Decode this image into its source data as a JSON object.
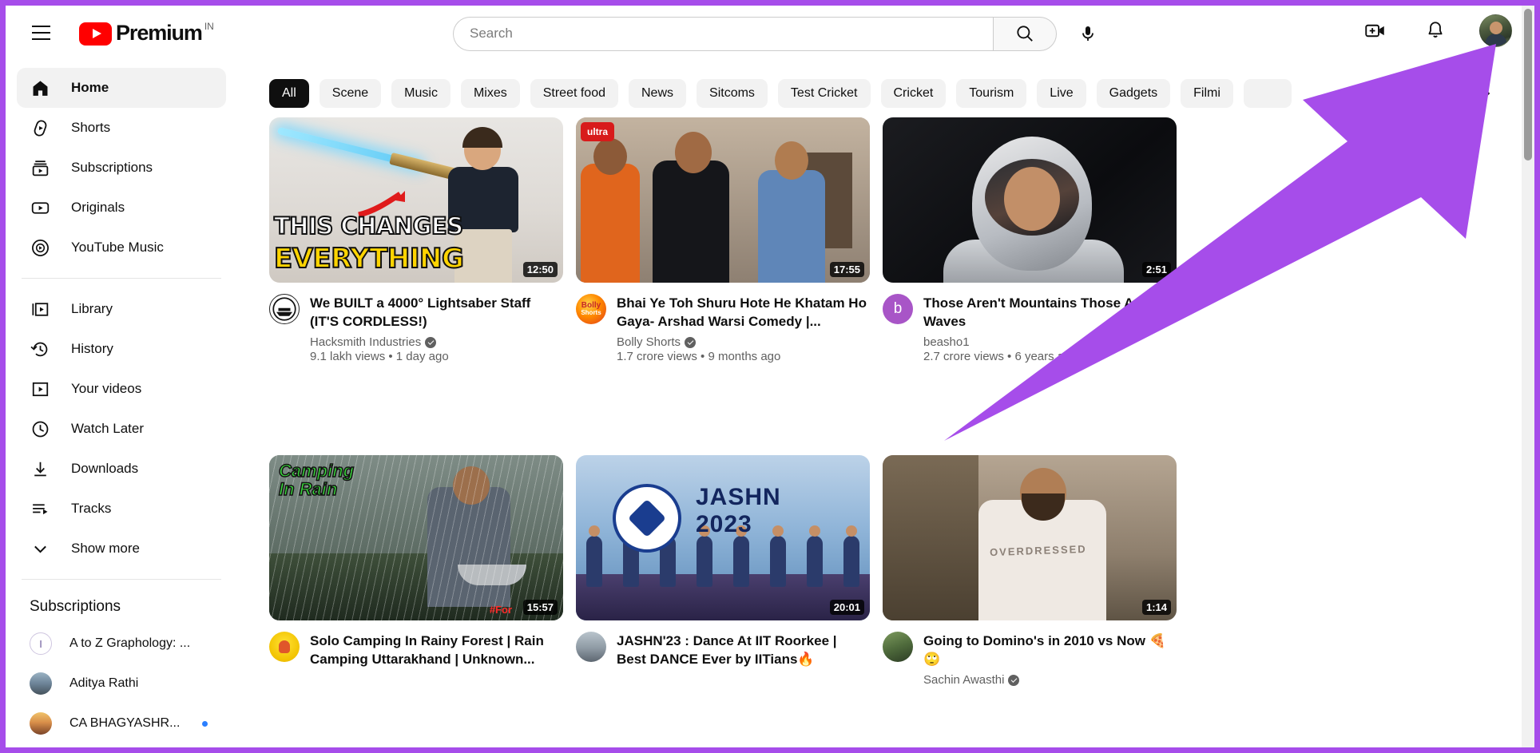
{
  "header": {
    "menu_label": "Menu",
    "logo_text": "Premium",
    "country_code": "IN",
    "search_placeholder": "Search",
    "search_value": "",
    "search_button_label": "Search",
    "mic_label": "Search with your voice",
    "create_label": "Create",
    "notifications_label": "Notifications",
    "account_label": "Account"
  },
  "sidebar": {
    "primary": [
      {
        "label": "Home",
        "icon": "home-icon",
        "active": true
      },
      {
        "label": "Shorts",
        "icon": "shorts-icon",
        "active": false
      },
      {
        "label": "Subscriptions",
        "icon": "subscriptions-icon",
        "active": false
      },
      {
        "label": "Originals",
        "icon": "originals-icon",
        "active": false
      },
      {
        "label": "YouTube Music",
        "icon": "youtube-music-icon",
        "active": false
      }
    ],
    "secondary": [
      {
        "label": "Library",
        "icon": "library-icon"
      },
      {
        "label": "History",
        "icon": "history-icon"
      },
      {
        "label": "Your videos",
        "icon": "your-videos-icon"
      },
      {
        "label": "Watch Later",
        "icon": "watch-later-icon"
      },
      {
        "label": "Downloads",
        "icon": "downloads-icon"
      },
      {
        "label": "Tracks",
        "icon": "tracks-icon"
      },
      {
        "label": "Show more",
        "icon": "chevron-down-icon"
      }
    ],
    "subscriptions_title": "Subscriptions",
    "subscriptions": [
      {
        "label": "A to Z Graphology: ...",
        "new": false
      },
      {
        "label": "Aditya Rathi",
        "new": false
      },
      {
        "label": "CA BHAGYASHR...",
        "new": true
      }
    ]
  },
  "chips": {
    "items": [
      {
        "label": "All",
        "selected": true
      },
      {
        "label": "Scene",
        "selected": false
      },
      {
        "label": "Music",
        "selected": false
      },
      {
        "label": "Mixes",
        "selected": false
      },
      {
        "label": "Street food",
        "selected": false
      },
      {
        "label": "News",
        "selected": false
      },
      {
        "label": "Sitcoms",
        "selected": false
      },
      {
        "label": "Test Cricket",
        "selected": false
      },
      {
        "label": "Cricket",
        "selected": false
      },
      {
        "label": "Tourism",
        "selected": false
      },
      {
        "label": "Live",
        "selected": false
      },
      {
        "label": "Gadgets",
        "selected": false
      },
      {
        "label": "Filmi",
        "selected": false
      }
    ],
    "next_label": "Next"
  },
  "videos": [
    {
      "title": "We BUILT a 4000° Lightsaber Staff (IT'S CORDLESS!)",
      "channel": "Hacksmith Industries",
      "verified": true,
      "stats": "9.1 lakh views • 1 day ago",
      "duration": "12:50",
      "thumb_text_1": "THIS CHANGES",
      "thumb_text_2": "EVERYTHING",
      "avatar_letter": ""
    },
    {
      "title": "Bhai Ye Toh Shuru Hote He Khatam Ho Gaya- Arshad Warsi Comedy |...",
      "channel": "Bolly Shorts",
      "verified": true,
      "stats": "1.7 crore views • 9 months ago",
      "duration": "17:55",
      "thumb_badge": "ultra",
      "avatar_letter": ""
    },
    {
      "title": "Those Aren't Mountains Those Are Waves",
      "channel": "beasho1",
      "verified": false,
      "stats": "2.7 crore views • 6 years ago",
      "duration": "2:51",
      "avatar_letter": "b"
    },
    {
      "title": "Solo Camping In Rainy Forest | Rain Camping Uttarakhand | Unknown...",
      "channel": "",
      "verified": false,
      "stats": "",
      "duration": "15:57",
      "thumb_label": "Camping\nIn Rain",
      "thumb_tag": "#For",
      "avatar_letter": ""
    },
    {
      "title": "JASHN'23 : Dance At IIT Roorkee | Best DANCE Ever by IITians🔥",
      "channel": "",
      "verified": false,
      "stats": "",
      "duration": "20:01",
      "thumb_title": "JASHN",
      "thumb_year": "2023",
      "avatar_letter": ""
    },
    {
      "title": "Going to Domino's in 2010 vs Now 🍕🙄",
      "channel": "Sachin Awasthi",
      "verified": true,
      "stats": "",
      "duration": "1:14",
      "avatar_letter": ""
    }
  ],
  "annotation": {
    "arrow_color": "#a64dea",
    "border_color": "#a64dea"
  }
}
